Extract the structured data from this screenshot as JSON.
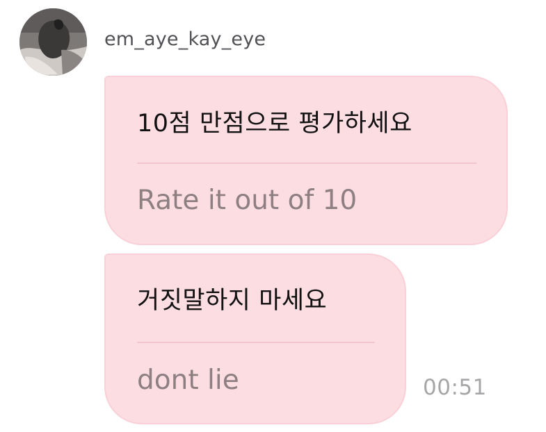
{
  "sender": {
    "username": "em_aye_kay_eye",
    "avatar_icon": "profile-photo"
  },
  "messages": [
    {
      "text": "10점 만점으로 평가하세요",
      "translation": "Rate it out of 10"
    },
    {
      "text": "거짓말하지 마세요",
      "translation": "dont lie"
    }
  ],
  "timestamp": "00:51",
  "colors": {
    "bubble_background": "#fcdde2",
    "bubble_border": "#f9d0d7",
    "translation_text": "#8d7f82",
    "timestamp_text": "#a6a6a8"
  }
}
